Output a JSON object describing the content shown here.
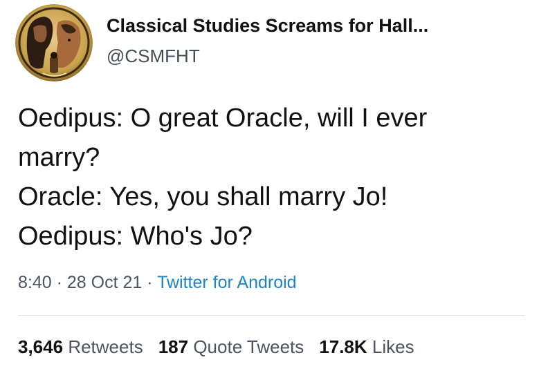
{
  "tweet": {
    "author": {
      "display_name": "Classical Studies Screams for Hall...",
      "handle": "@CSMFHT",
      "avatar_icon": "greek-vase-avatar-icon"
    },
    "text_lines": [
      "Oedipus: O great Oracle, will I ever",
      "marry?",
      "Oracle: Yes, you shall marry Jo!",
      "Oedipus: Who's Jo?"
    ],
    "time": "8:40",
    "separator": "·",
    "date": "28 Oct 21",
    "source": "Twitter for Android",
    "stats": {
      "retweets": {
        "count": "3,646",
        "label": "Retweets"
      },
      "quote_tweets": {
        "count": "187",
        "label": "Quote Tweets"
      },
      "likes": {
        "count": "17.8K",
        "label": "Likes"
      }
    }
  },
  "colors": {
    "text": "#111111",
    "secondary": "#4b5560",
    "link": "#1d84c6",
    "divider": "#dfe3e6"
  }
}
